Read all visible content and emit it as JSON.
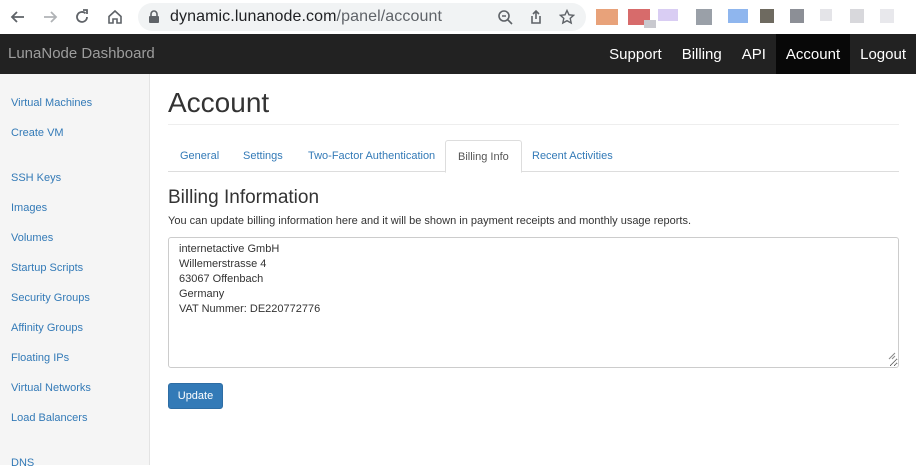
{
  "browser": {
    "url_host": "dynamic.lunanode.com",
    "url_path": "/panel/account"
  },
  "topnav": {
    "brand": "LunaNode Dashboard",
    "links": [
      {
        "label": "Support"
      },
      {
        "label": "Billing"
      },
      {
        "label": "API"
      },
      {
        "label": "Account",
        "active": true
      },
      {
        "label": "Logout"
      }
    ]
  },
  "sidebar": {
    "items": [
      {
        "label": "Virtual Machines"
      },
      {
        "label": "Create VM"
      },
      {
        "label": "SSH Keys"
      },
      {
        "label": "Images"
      },
      {
        "label": "Volumes"
      },
      {
        "label": "Startup Scripts"
      },
      {
        "label": "Security Groups"
      },
      {
        "label": "Affinity Groups"
      },
      {
        "label": "Floating IPs"
      },
      {
        "label": "Virtual Networks"
      },
      {
        "label": "Load Balancers"
      },
      {
        "label": "DNS"
      }
    ]
  },
  "main": {
    "title": "Account",
    "tabs": [
      {
        "label": "General"
      },
      {
        "label": "Settings"
      },
      {
        "label": "Two-Factor Authentication"
      },
      {
        "label": "Billing Info",
        "active": true
      },
      {
        "label": "Recent Activities"
      }
    ],
    "section_title": "Billing Information",
    "description": "You can update billing information here and it will be shown in payment receipts and monthly usage reports.",
    "billing_lines": [
      "internetactive GmbH",
      "Willemerstrasse 4",
      "63067 Offenbach",
      "Germany",
      "VAT Nummer: DE220772776"
    ],
    "update_label": "Update"
  },
  "colors": {
    "link": "#337ab7",
    "navbar": "#222222",
    "navbar_active": "#080808",
    "button_primary": "#337ab7"
  }
}
